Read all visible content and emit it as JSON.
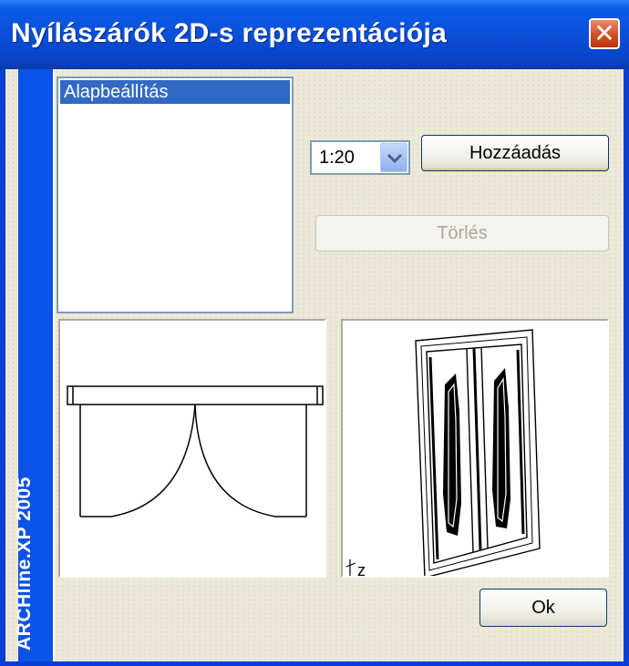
{
  "window": {
    "title": "Nyílászárók 2D-s reprezentációja",
    "close_glyph": "✕"
  },
  "sidebar": {
    "brand": "ARCHline.XP 2005"
  },
  "list": {
    "items": [
      {
        "label": "Alapbeállítás",
        "selected": true
      }
    ]
  },
  "scale": {
    "selected": "1:20",
    "icon": "chevron-down-icon"
  },
  "buttons": {
    "add": "Hozzáadás",
    "delete": "Törlés",
    "ok": "Ok"
  },
  "preview": {
    "axis_label": "z"
  },
  "colors": {
    "titlebar": "#0a4fd8",
    "sidebar": "#0a52e8",
    "selection": "#316ac5",
    "close": "#d24a22"
  }
}
